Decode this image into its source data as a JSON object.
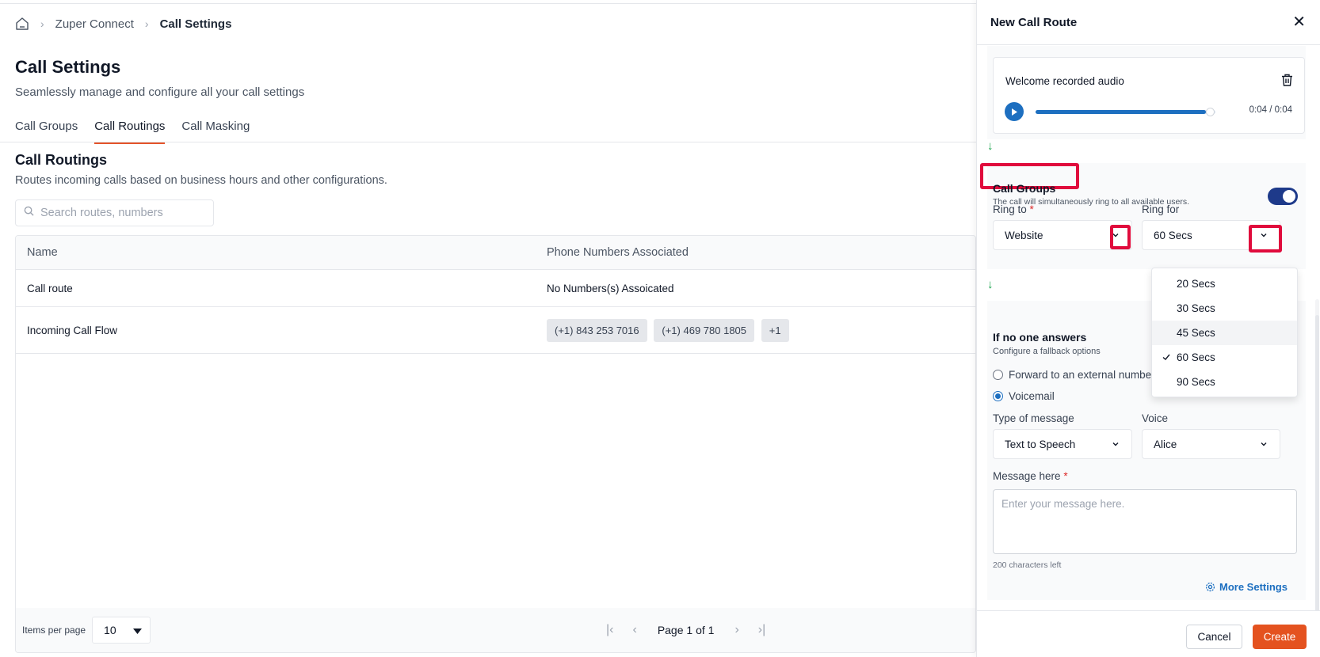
{
  "breadcrumb": {
    "home_icon": "home-icon",
    "item1": "Zuper Connect",
    "item2": "Call Settings"
  },
  "page": {
    "title": "Call Settings",
    "subtitle": "Seamlessly manage and configure all your call settings"
  },
  "tabs": [
    {
      "label": "Call Groups"
    },
    {
      "label": "Call Routings"
    },
    {
      "label": "Call Masking"
    }
  ],
  "active_tab": "Call Routings",
  "section": {
    "title": "Call Routings",
    "subtitle": "Routes incoming calls based on business hours and other configurations."
  },
  "search": {
    "placeholder": "Search routes, numbers"
  },
  "table": {
    "columns": [
      "Name",
      "Phone Numbers Associated"
    ],
    "rows": [
      {
        "name": "Call route",
        "numbers_text": "No Numbers(s) Assoicated"
      },
      {
        "name": "Incoming Call Flow",
        "chips": [
          "(+1) 843 253 7016",
          "(+1) 469 780 1805",
          "+1"
        ]
      }
    ]
  },
  "pagination": {
    "items_per_page_label": "Items per page",
    "items_per_page": "10",
    "page_label": "Page 1 of 1"
  },
  "drawer": {
    "title": "New Call Route",
    "audio": {
      "title": "Welcome recorded audio",
      "time": "0:04 / 0:04",
      "progress": 1.0
    },
    "call_groups": {
      "title": "Call Groups",
      "description": "The call will simultaneously ring to all available users.",
      "enabled": true,
      "ring_to_label": "Ring to",
      "ring_to_value": "Website",
      "ring_for_label": "Ring for",
      "ring_for_value": "60 Secs"
    },
    "ring_for_options": [
      "20 Secs",
      "30 Secs",
      "45 Secs",
      "60 Secs",
      "90 Secs"
    ],
    "ring_for_selected": "60 Secs",
    "ring_for_hovered": "45 Secs",
    "fallback": {
      "title": "If no one answers",
      "subtitle": "Configure a fallback options",
      "option_forward": "Forward to an external number",
      "option_voicemail": "Voicemail",
      "selected": "Voicemail"
    },
    "message_type_label": "Type of message",
    "message_type_value": "Text to Speech",
    "voice_label": "Voice",
    "voice_value": "Alice",
    "message_label": "Message here",
    "message_placeholder": "Enter your message here.",
    "chars_left": "200 characters left",
    "more_settings": "More Settings",
    "cancel_label": "Cancel",
    "create_label": "Create"
  },
  "colors": {
    "accent": "#e4532a",
    "primary_blue": "#1d6fc0",
    "toggle_navy": "#1e3a8a",
    "highlight_red": "#e00b3c",
    "flow_arrow_green": "#16a34a"
  }
}
